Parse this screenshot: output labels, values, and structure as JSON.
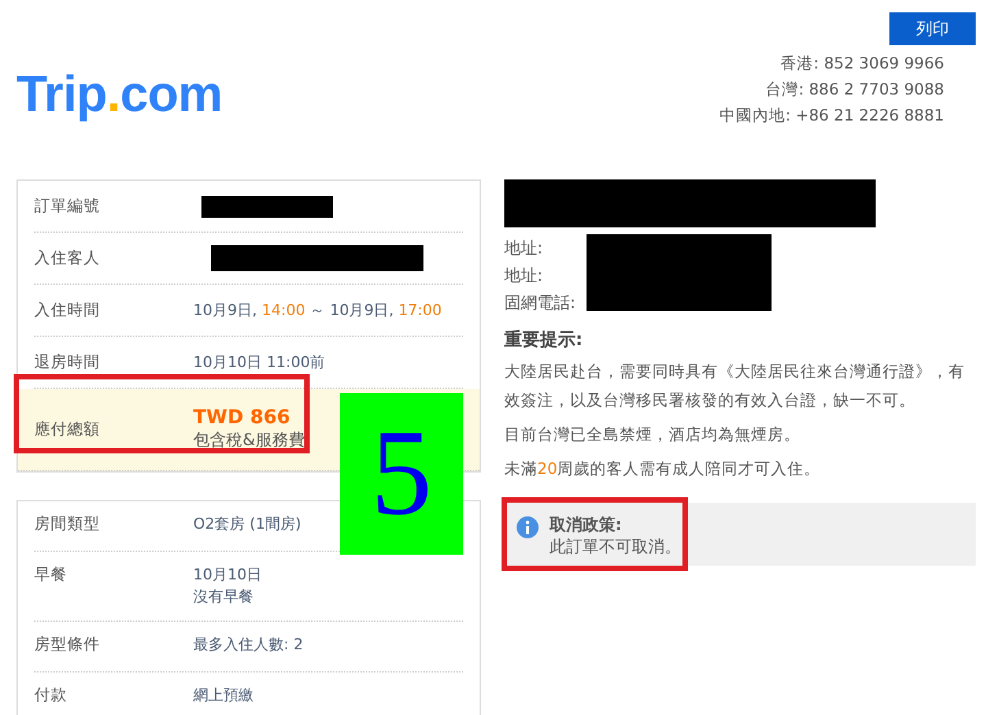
{
  "header": {
    "logo": {
      "left": "Trip",
      "dot": ".",
      "right": "com"
    },
    "print_button": "列印",
    "phones": [
      "香港: 852 3069 9966",
      "台灣: 886 2 7703 9088",
      "中國內地: +86 21 2226 8881"
    ]
  },
  "booking_card": {
    "rows": [
      {
        "label": "訂單編號",
        "kind": "redacted"
      },
      {
        "label": "入住客人",
        "kind": "redacted"
      },
      {
        "label": "入住時間",
        "kind": "segments",
        "segments": [
          {
            "text": "10月9日, ",
            "emphasis": false
          },
          {
            "text": "14:00",
            "emphasis": true
          },
          {
            "text": " ～ 10月9日, ",
            "emphasis": false
          },
          {
            "text": "17:00",
            "emphasis": true
          }
        ]
      },
      {
        "label": "退房時間",
        "kind": "text",
        "lines": [
          "10月10日 11:00前"
        ]
      },
      {
        "label": "應付總額",
        "kind": "total",
        "amount": "TWD 866",
        "note": "包含稅&服務費"
      }
    ]
  },
  "room_card": {
    "rows": [
      {
        "label": "房間類型",
        "lines": [
          "O2套房 (1間房)"
        ]
      },
      {
        "label": "早餐",
        "lines": [
          "10月10日",
          "沒有早餐"
        ]
      },
      {
        "label": "房型條件",
        "lines": [
          "最多入住人數: 2"
        ]
      },
      {
        "label": "付款",
        "lines": [
          "網上預繳"
        ]
      }
    ]
  },
  "hotel": {
    "fields": [
      "地址:",
      "地址:",
      "固網電話:"
    ],
    "notice_title": "重要提示:",
    "notice_lines": [
      [
        {
          "text": "大陸居民赴台，需要同時具有《大陸居民往來台灣通行證》，有效簽注，以及台灣移民署核發的有效入台證，缺一不可。",
          "emphasis": false
        }
      ],
      [
        {
          "text": "目前台灣已全島禁煙，酒店均為無煙房。",
          "emphasis": false
        }
      ],
      [
        {
          "text": "未滿",
          "emphasis": false
        },
        {
          "text": "20",
          "emphasis": true
        },
        {
          "text": "周歲的客人需有成人陪同才可入住。",
          "emphasis": false
        }
      ]
    ],
    "cancellation": {
      "title": "取消政策:",
      "text": "此訂單不可取消。"
    }
  },
  "annotation": {
    "label": "5"
  }
}
